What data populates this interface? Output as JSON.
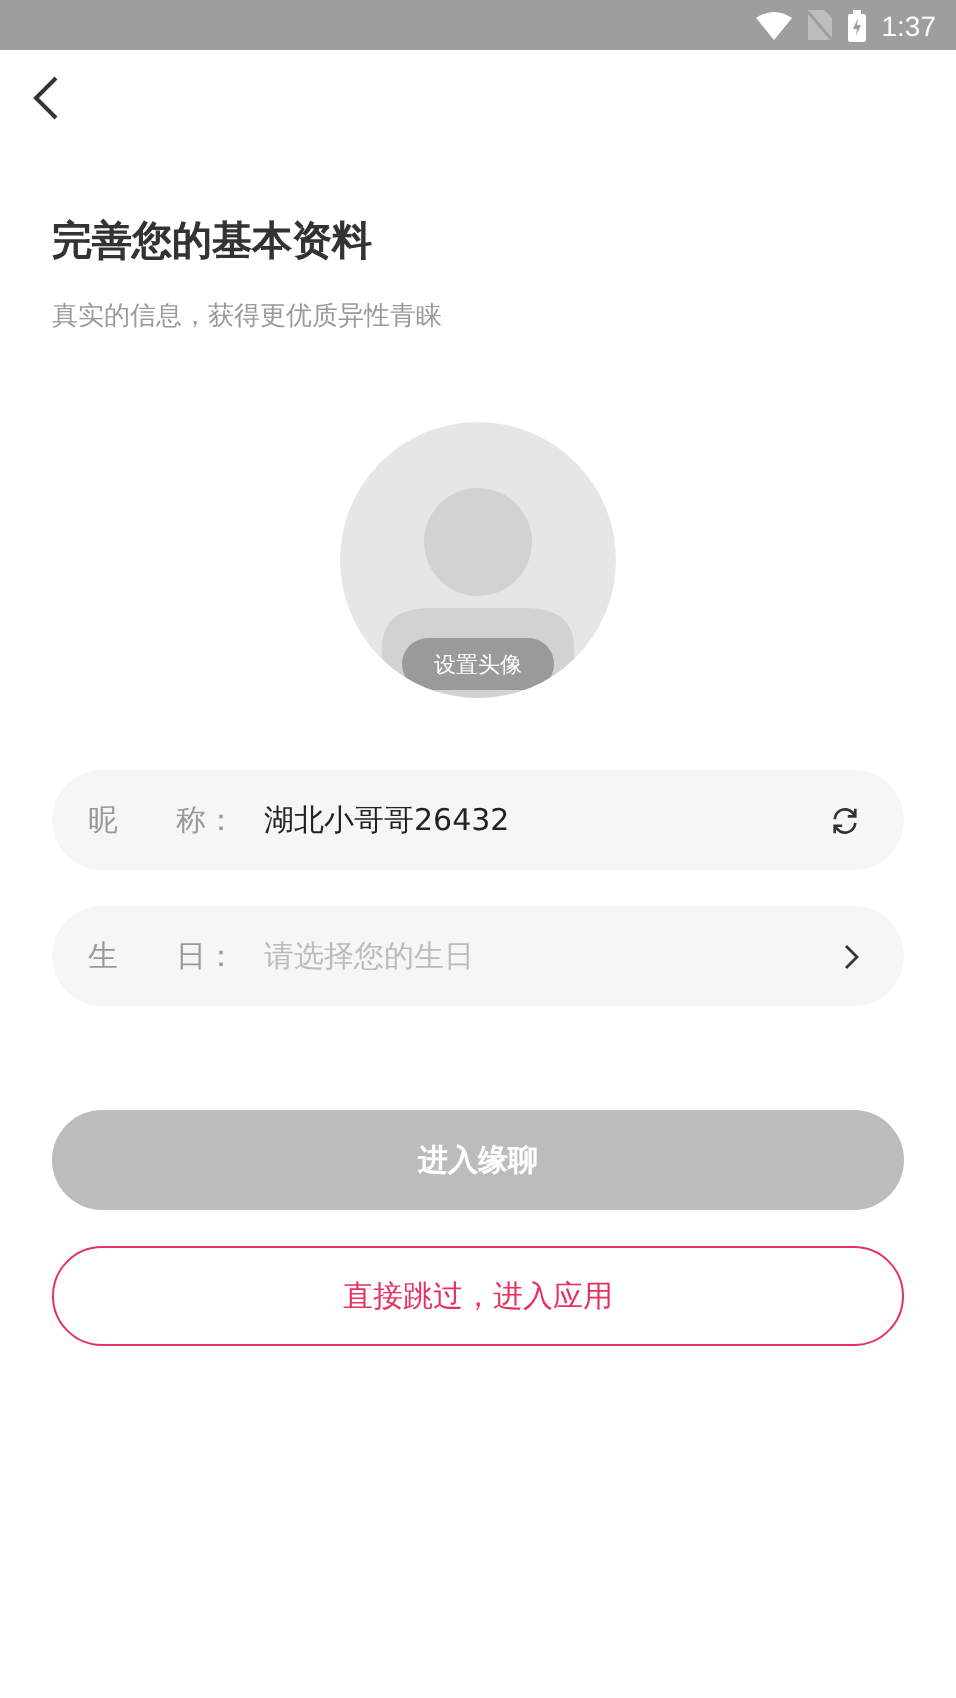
{
  "status_bar": {
    "time": "1:37"
  },
  "title": "完善您的基本资料",
  "subtitle": "真实的信息，获得更优质异性青睐",
  "avatar": {
    "caption": "设置头像"
  },
  "fields": [
    {
      "kind": "nickname",
      "label": "昵 称：",
      "value": "湖北小哥哥26432"
    },
    {
      "kind": "picker",
      "label": "生 日：",
      "placeholder": "请选择您的生日"
    }
  ],
  "submit": {
    "label": "进入缘聊",
    "disabled": true
  },
  "skip": {
    "label": "直接跳过，进入应用"
  }
}
